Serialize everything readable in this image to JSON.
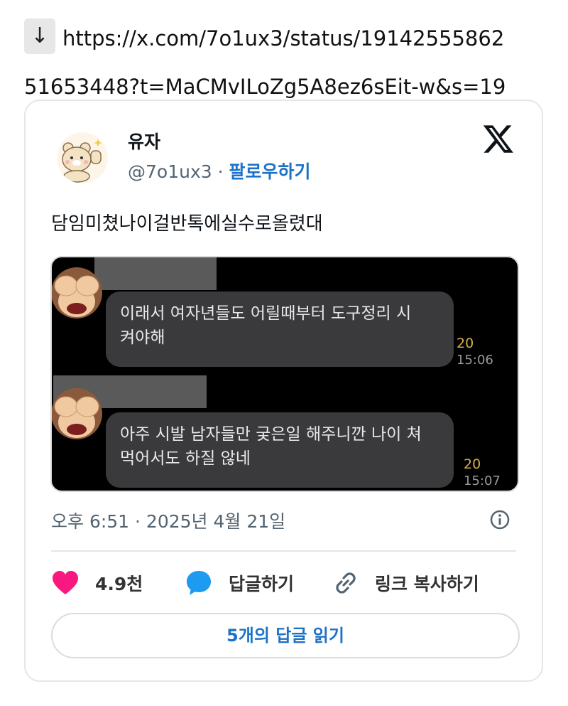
{
  "link": {
    "arrow": "↓",
    "line1": "https://x.com/7o1ux3/status/19142555862",
    "line2": "51653448?t=MaCMvILoZg5A8ez6sEit-w&s=19"
  },
  "tweet": {
    "display_name": "유자",
    "handle": "@7o1ux3",
    "separator": "·",
    "follow_label": "팔로우하기",
    "text": "담임미쳤나이걸반톡에실수로올렸대",
    "timestamp": "오후 6:51 · 2025년 4월 21일"
  },
  "screenshot": {
    "messages": [
      {
        "line1": "이래서 여자년들도 어릴때부터 도구정리 시",
        "line2": "켜야해",
        "count": "20",
        "time": "15:06"
      },
      {
        "line1": "아주 시발 남자들만 궂은일 해주니깐 나이 쳐",
        "line2": "먹어서도 하질 않네",
        "count": "20",
        "time": "15:07"
      }
    ]
  },
  "actions": {
    "like_count": "4.9천",
    "reply_label": "답글하기",
    "copy_link_label": "링크 복사하기",
    "read_replies_label": "5개의 답글 읽기"
  },
  "colors": {
    "like": "#f91880",
    "reply": "#1d9bf0",
    "follow_link": "#1d72c8",
    "bubble": "#3a3a3c"
  },
  "icons": [
    "down-arrow-icon",
    "x-logo-icon",
    "info-icon",
    "heart-icon",
    "reply-bubble-icon",
    "link-icon"
  ]
}
